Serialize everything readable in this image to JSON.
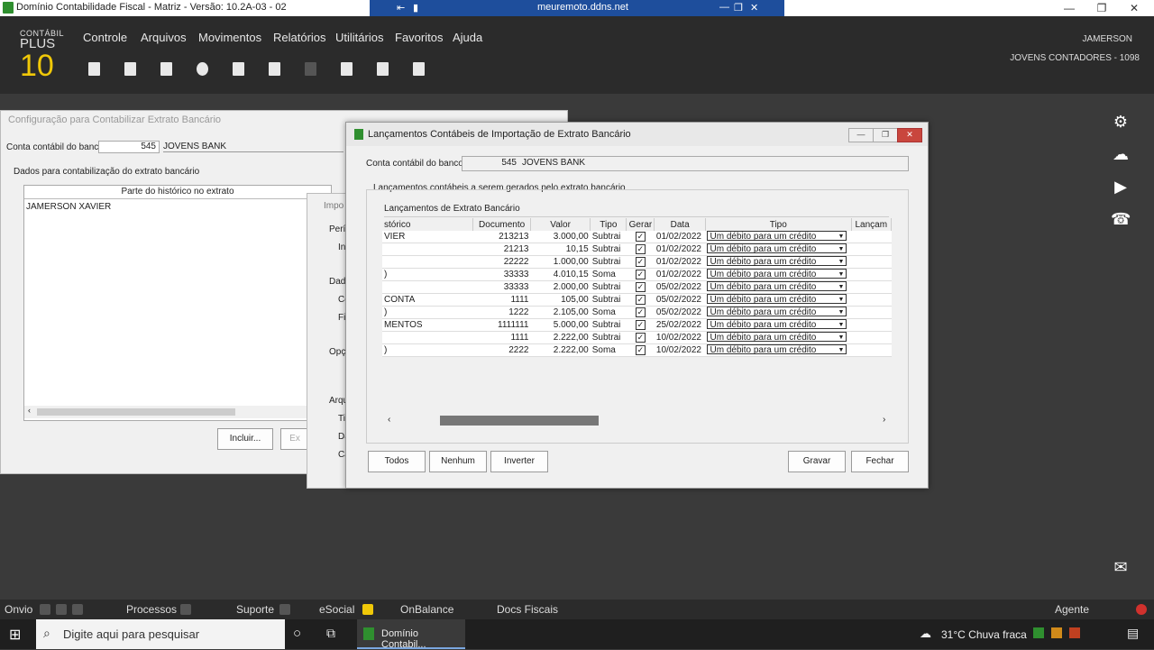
{
  "window": {
    "title": "Domínio Contabilidade Fiscal - Matriz - Versão: 10.2A-03 - 02",
    "remote_host": "meuremoto.ddns.net"
  },
  "logo": {
    "line1": "CONTÁBIL",
    "line2": "PLUS",
    "line3": "10"
  },
  "menu": [
    "Controle",
    "Arquivos",
    "Movimentos",
    "Relatórios",
    "Utilitários",
    "Favoritos",
    "Ajuda"
  ],
  "user": {
    "name": "JAMERSON",
    "company": "JOVENS CONTADORES",
    "company_code": "- 1098"
  },
  "bg_dialog": {
    "title": "Configuração para Contabilizar Extrato Bancário",
    "account_label": "Conta contábil do banco:",
    "account_number": "545",
    "account_name": "JOVENS BANK",
    "group_label": "Dados para contabilização do extrato bancário",
    "column_header": "Parte do histórico no extrato",
    "row": "JAMERSON XAVIER",
    "include_button": "Incluir...",
    "exclude_button": "Ex"
  },
  "partial_dialog": {
    "title": "Impo",
    "labels": [
      "Perío",
      "Ini",
      "Dado",
      "Co",
      "Fil",
      "Opç",
      "Arqu",
      "Tip",
      "Da",
      "Ca"
    ]
  },
  "main_dialog": {
    "title": "Lançamentos Contábeis de Importação de Extrato Bancário",
    "account_label": "Conta contábil do banco:",
    "account_number": "545",
    "account_name": "JOVENS BANK",
    "group_label": "Lançamentos contábeis a serem gerados pelo extrato bancário",
    "grid_title": "Lançamentos de Extrato Bancário",
    "columns": [
      "stórico",
      "Documento",
      "Valor",
      "Tipo",
      "Gerar",
      "Data",
      "Tipo",
      "Lançam"
    ],
    "rows": [
      {
        "hist": "VIER",
        "doc": "213213",
        "valor": "3.000,00",
        "tipo": "Subtrai",
        "data": "01/02/2022",
        "lanc": "Um débito para um crédito"
      },
      {
        "hist": "",
        "doc": "21213",
        "valor": "10,15",
        "tipo": "Subtrai",
        "data": "01/02/2022",
        "lanc": "Um débito para um crédito"
      },
      {
        "hist": "",
        "doc": "22222",
        "valor": "1.000,00",
        "tipo": "Subtrai",
        "data": "01/02/2022",
        "lanc": "Um débito para um crédito"
      },
      {
        "hist": ")",
        "doc": "33333",
        "valor": "4.010,15",
        "tipo": "Soma",
        "data": "01/02/2022",
        "lanc": "Um débito para um crédito"
      },
      {
        "hist": "",
        "doc": "33333",
        "valor": "2.000,00",
        "tipo": "Subtrai",
        "data": "05/02/2022",
        "lanc": "Um débito para um crédito"
      },
      {
        "hist": "CONTA",
        "doc": "1111",
        "valor": "105,00",
        "tipo": "Subtrai",
        "data": "05/02/2022",
        "lanc": "Um débito para um crédito"
      },
      {
        "hist": ")",
        "doc": "1222",
        "valor": "2.105,00",
        "tipo": "Soma",
        "data": "05/02/2022",
        "lanc": "Um débito para um crédito"
      },
      {
        "hist": "MENTOS",
        "doc": "1111111",
        "valor": "5.000,00",
        "tipo": "Subtrai",
        "data": "25/02/2022",
        "lanc": "Um débito para um crédito"
      },
      {
        "hist": "",
        "doc": "1111",
        "valor": "2.222,00",
        "tipo": "Subtrai",
        "data": "10/02/2022",
        "lanc": "Um débito para um crédito"
      },
      {
        "hist": ")",
        "doc": "2222",
        "valor": "2.222,00",
        "tipo": "Soma",
        "data": "10/02/2022",
        "lanc": "Um débito para um crédito"
      }
    ],
    "buttons": {
      "all": "Todos",
      "none": "Nenhum",
      "invert": "Inverter",
      "save": "Gravar",
      "close": "Fechar"
    }
  },
  "statusbar": [
    "Onvio",
    "Processos",
    "Suporte",
    "eSocial",
    "OnBalance",
    "Docs Fiscais",
    "Agente"
  ],
  "taskbar": {
    "search_placeholder": "Digite aqui para pesquisar",
    "app_label": "Domínio Contabil...",
    "weather": "31°C  Chuva fraca"
  }
}
